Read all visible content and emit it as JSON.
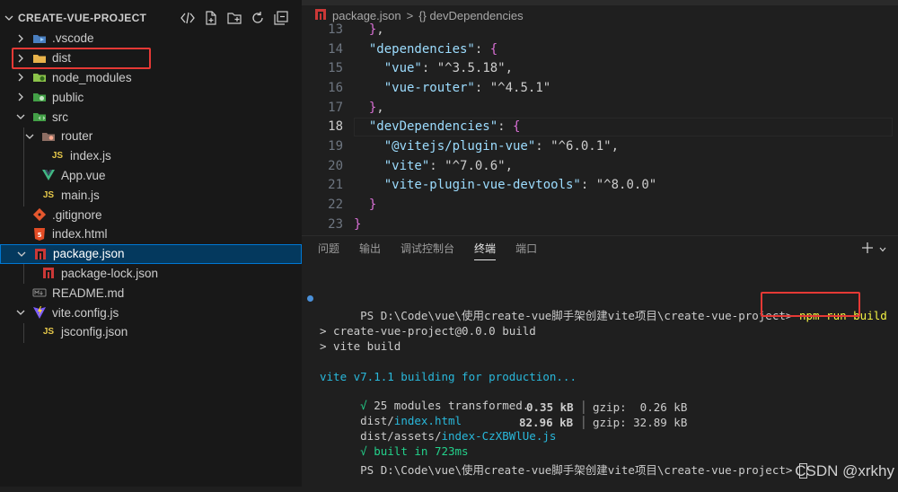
{
  "explorer": {
    "title": "CREATE-VUE-PROJECT",
    "items": [
      {
        "label": ".vscode",
        "depth": 0,
        "twisty": "right",
        "icon": "vscode-folder-icon"
      },
      {
        "label": "dist",
        "depth": 0,
        "twisty": "right",
        "icon": "folder-icon"
      },
      {
        "label": "node_modules",
        "depth": 0,
        "twisty": "right",
        "icon": "node-folder-icon"
      },
      {
        "label": "public",
        "depth": 0,
        "twisty": "right",
        "icon": "public-folder-icon"
      },
      {
        "label": "src",
        "depth": 0,
        "twisty": "down",
        "icon": "src-folder-icon"
      },
      {
        "label": "router",
        "depth": 1,
        "twisty": "down",
        "icon": "router-folder-icon"
      },
      {
        "label": "index.js",
        "depth": 2,
        "twisty": "",
        "icon": "js-icon"
      },
      {
        "label": "App.vue",
        "depth": 1,
        "twisty": "",
        "icon": "vue-icon"
      },
      {
        "label": "main.js",
        "depth": 1,
        "twisty": "",
        "icon": "js-icon"
      },
      {
        "label": ".gitignore",
        "depth": 0,
        "twisty": "",
        "icon": "git-icon"
      },
      {
        "label": "index.html",
        "depth": 0,
        "twisty": "",
        "icon": "html-icon"
      },
      {
        "label": "package.json",
        "depth": 0,
        "twisty": "down",
        "icon": "npm-icon",
        "selected": true
      },
      {
        "label": "package-lock.json",
        "depth": 1,
        "twisty": "",
        "icon": "npm-icon"
      },
      {
        "label": "README.md",
        "depth": 0,
        "twisty": "",
        "icon": "markdown-icon"
      },
      {
        "label": "vite.config.js",
        "depth": 0,
        "twisty": "down",
        "icon": "vite-icon"
      },
      {
        "label": "jsconfig.json",
        "depth": 1,
        "twisty": "",
        "icon": "js-icon"
      }
    ]
  },
  "editor": {
    "breadcrumb": {
      "file": "package.json",
      "separator": ">",
      "symbol": "{} devDependencies"
    },
    "lines": [
      {
        "n": "13",
        "text": "  },"
      },
      {
        "n": "14",
        "text": "  \"dependencies\": {"
      },
      {
        "n": "15",
        "text": "    \"vue\": \"^3.5.18\","
      },
      {
        "n": "16",
        "text": "    \"vue-router\": \"^4.5.1\""
      },
      {
        "n": "17",
        "text": "  },"
      },
      {
        "n": "18",
        "text": "  \"devDependencies\": {"
      },
      {
        "n": "19",
        "text": "    \"@vitejs/plugin-vue\": \"^6.0.1\","
      },
      {
        "n": "20",
        "text": "    \"vite\": \"^7.0.6\","
      },
      {
        "n": "21",
        "text": "    \"vite-plugin-vue-devtools\": \"^8.0.0\""
      },
      {
        "n": "22",
        "text": "  }"
      },
      {
        "n": "23",
        "text": "}"
      }
    ],
    "current_line": "18"
  },
  "panel": {
    "tabs": [
      "问题",
      "输出",
      "调试控制台",
      "终端",
      "端口"
    ],
    "active_tab": "终端",
    "terminal": {
      "prompt1": "PS D:\\Code\\vue\\使用create-vue脚手架创建vite项目\\create-vue-project>",
      "command": "npm run build",
      "script1": "> create-vue-project@0.0.0 build",
      "script2": "> vite build",
      "vite_line": "vite v7.1.1 building for production...",
      "check": "√",
      "transformed": "25 modules transformed.",
      "file1_dir": "dist/",
      "file1_name": "index.html",
      "file1_size": "0.35 kB",
      "file1_gzip": "gzip:  0.26 kB",
      "file2_dir": "dist/assets/",
      "file2_name": "index-CzXBWlUe.js",
      "file2_size": "82.96 kB",
      "file2_gzip": "gzip: 32.89 kB",
      "sep": "│",
      "built": "built in 723ms",
      "prompt2": "PS D:\\Code\\vue\\使用create-vue脚手架创建vite项目\\create-vue-project>"
    }
  },
  "watermark": "CSDN @xrkhy",
  "colors": {
    "accent": "#0078d4",
    "highlight_box": "#e53935",
    "sidebar_bg": "#181818",
    "editor_bg": "#1f1f1f"
  }
}
